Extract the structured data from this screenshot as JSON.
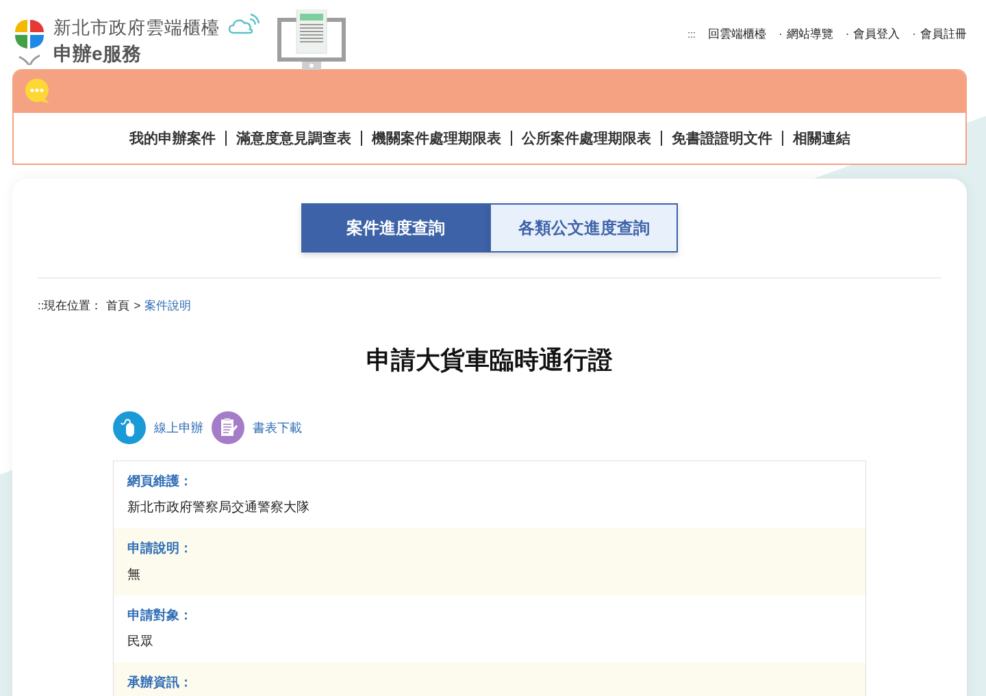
{
  "header": {
    "site_name": "新北市政府雲端櫃檯",
    "service_name": "申辦e服務",
    "accesskey": ":::",
    "top_links": [
      {
        "label": "回雲端櫃檯"
      },
      {
        "marker": "·",
        "label": "網站導覽"
      },
      {
        "marker": "·",
        "label": "會員登入"
      },
      {
        "marker": "·",
        "label": "會員註冊"
      }
    ]
  },
  "nav": {
    "items": [
      "我的申辦案件",
      "滿意度意見調查表",
      "機關案件處理期限表",
      "公所案件處理期限表",
      "免書證證明文件",
      "相關連結"
    ]
  },
  "tabs": [
    {
      "label": "案件進度查詢",
      "selected": true
    },
    {
      "label": "各類公文進度查詢",
      "selected": false
    }
  ],
  "breadcrumb": {
    "prefix": "::現在位置：",
    "home": "首頁",
    "arrow": ">",
    "current": "案件說明"
  },
  "title": "申請大貨車臨時通行證",
  "actions": [
    {
      "kind": "online",
      "label": "線上申辦"
    },
    {
      "kind": "download",
      "label": "書表下載"
    }
  ],
  "info": [
    {
      "label": "網頁維護：",
      "value": "新北市政府警察局交通警察大隊"
    },
    {
      "label": "申請說明：",
      "value": "無"
    },
    {
      "label": "申請對象：",
      "value": "民眾"
    },
    {
      "label": "承辦資訊："
    }
  ]
}
